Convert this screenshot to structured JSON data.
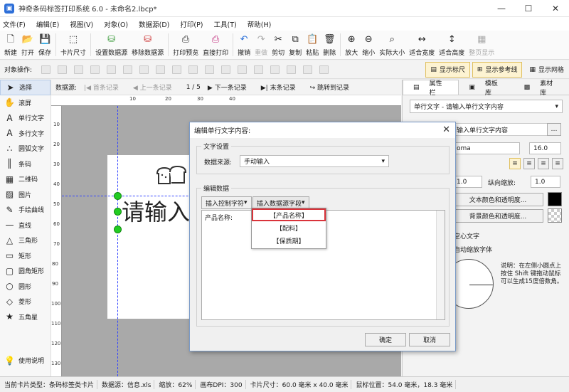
{
  "app": {
    "title": "神奇条码标签打印系统 6.0 - 未命名2.lbcp*"
  },
  "menu": [
    "文件(F)",
    "编辑(E)",
    "视图(V)",
    "对象(O)",
    "数据源(D)",
    "打印(P)",
    "工具(T)",
    "帮助(H)"
  ],
  "toolbar": [
    "新建",
    "打开",
    "保存",
    "卡片尺寸",
    "设置数据源",
    "移除数据源",
    "打印预览",
    "直接打印",
    "撤销",
    "重做",
    "剪切",
    "复制",
    "粘贴",
    "删除",
    "放大",
    "缩小",
    "实际大小",
    "适合宽度",
    "适合高度",
    "整页显示"
  ],
  "objbar": {
    "label": "对象操作:",
    "show_ruler": "显示标尺",
    "show_guides": "显示参考线",
    "show_grid": "显示网格"
  },
  "tools": [
    "选择",
    "滚屏",
    "单行文字",
    "多行文字",
    "圆弧文字",
    "条码",
    "二维码",
    "图片",
    "手绘曲线",
    "直线",
    "三角形",
    "矩形",
    "圆角矩形",
    "圆形",
    "菱形",
    "五角星",
    "使用说明"
  ],
  "recbar": {
    "label": "数据源:",
    "first": "首条记录",
    "prev": "上一条记录",
    "page": "1 / 5",
    "next": "下一条记录",
    "last": "末条记录",
    "jump": "跳转到记录"
  },
  "ruler": {
    "h": [
      "10",
      "20",
      "30",
      "40"
    ],
    "v": [
      "10",
      "20",
      "30",
      "40",
      "50",
      "60",
      "70",
      "80",
      "90",
      "100",
      "110",
      "120",
      "130"
    ]
  },
  "canvas": {
    "text": "请输入"
  },
  "right": {
    "tabs": [
      "属性栏",
      "模板库",
      "素材库"
    ],
    "object": "单行文字 - 请输入单行文字内容",
    "content": "输入单行文字内容",
    "font": "oma",
    "font_size": "16.0",
    "hscale": "1.0",
    "vscale_label": "纵向缩放:",
    "vscale": "1.0",
    "color_btn": "文本颜色和透明度...",
    "bg_btn": "背景颜色和透明度...",
    "hollow": "空心文字",
    "autoscale": "自动缩放字体",
    "note": "说明：在左侧小圆点上按住 Shift 键拖动鼠标可以生成15度倍数角。"
  },
  "status": [
    "当前卡片类型：条码标签类卡片",
    "数据源：信息.xls",
    "缩放：62%",
    "画布DPI：300",
    "卡片尺寸：60.0 毫米 x 40.0 毫米",
    "鼠标位置：54.0 毫米，18.3 毫米"
  ],
  "dialog": {
    "title": "编辑单行文字内容:",
    "group1": "文字设置",
    "source_label": "数据来源:",
    "source_value": "手动输入",
    "group2": "编辑数据",
    "tab1": "插入控制字符",
    "tab2": "插入数据源字段",
    "text": "产品名称:",
    "ok": "确定",
    "cancel": "取消"
  },
  "dropdown": [
    "【产品名称】",
    "【配料】",
    "【保质期】"
  ]
}
